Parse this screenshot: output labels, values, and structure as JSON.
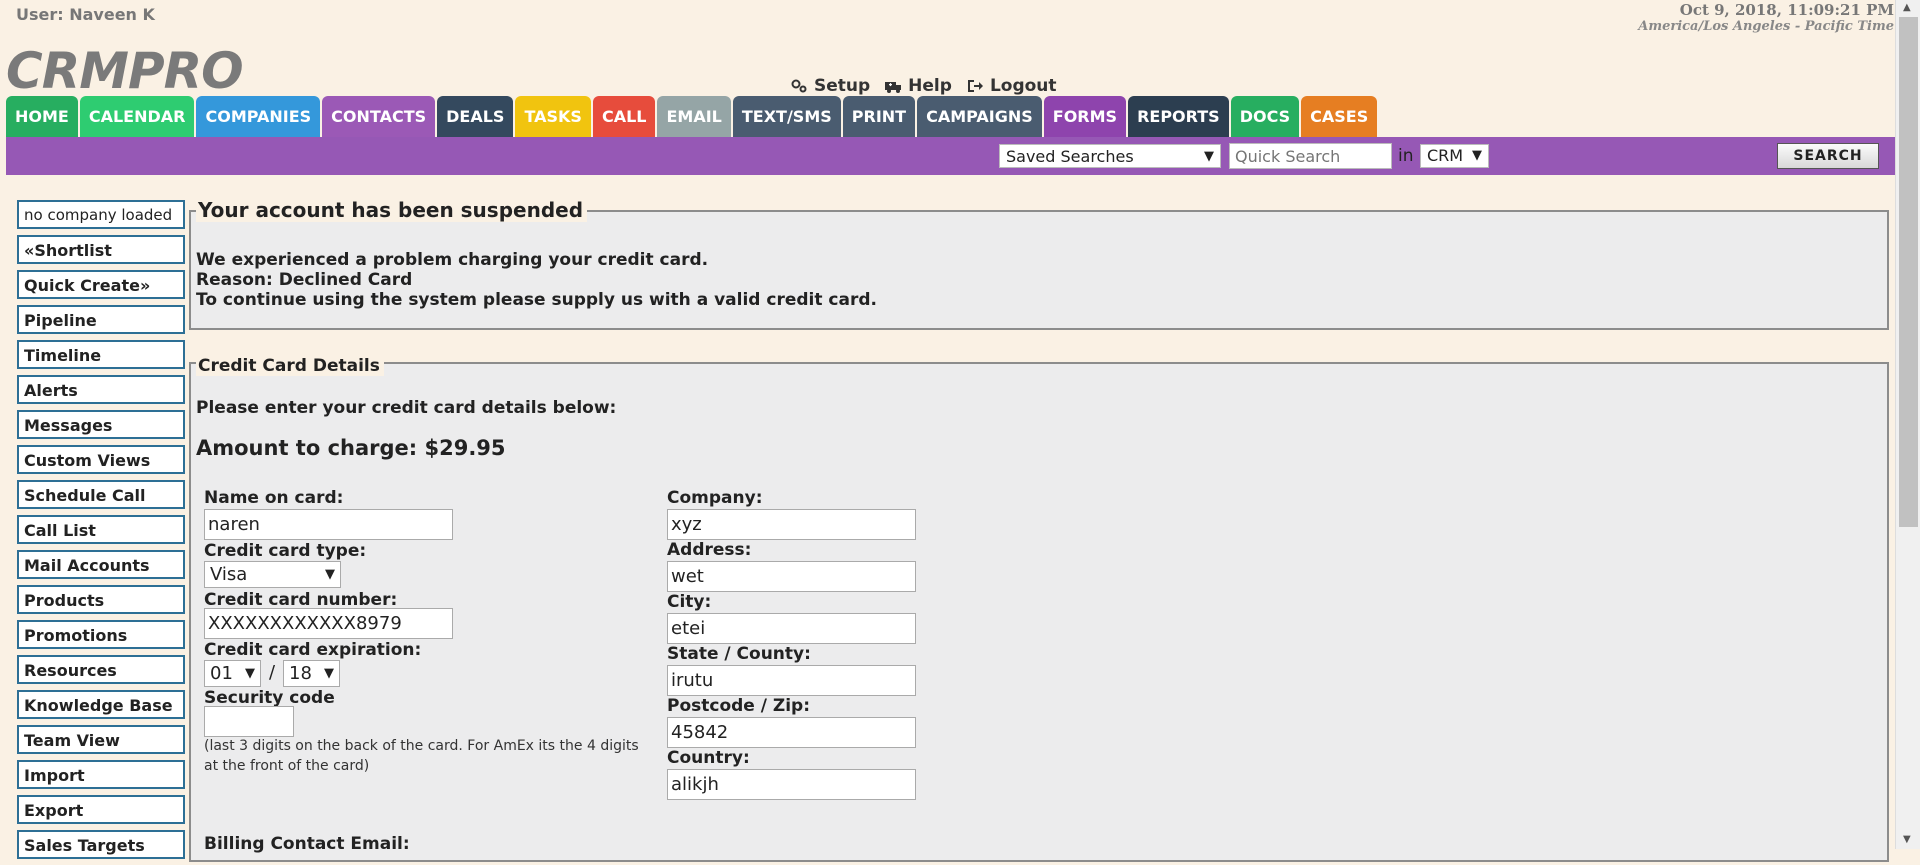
{
  "header": {
    "user": "User: Naveen K",
    "date": "Oct 9, 2018, 11:09:21 PM",
    "timezone": "America/Los Angeles - Pacific Time",
    "logo": "CRMPRO",
    "links": {
      "setup": "Setup",
      "help": "Help",
      "logout": "Logout"
    }
  },
  "nav": {
    "tabs": [
      {
        "label": "HOME",
        "color": "#27ae60"
      },
      {
        "label": "CALENDAR",
        "color": "#2ecc71"
      },
      {
        "label": "COMPANIES",
        "color": "#3498db"
      },
      {
        "label": "CONTACTS",
        "color": "#9b59b6"
      },
      {
        "label": "DEALS",
        "color": "#34495e"
      },
      {
        "label": "TASKS",
        "color": "#f1c40f"
      },
      {
        "label": "CALL",
        "color": "#e74c3c"
      },
      {
        "label": "EMAIL",
        "color": "#95a5a6"
      },
      {
        "label": "TEXT/SMS",
        "color": "#4a5c70"
      },
      {
        "label": "PRINT",
        "color": "#4a5c70"
      },
      {
        "label": "CAMPAIGNS",
        "color": "#4a5c70"
      },
      {
        "label": "FORMS",
        "color": "#8e44ad"
      },
      {
        "label": "REPORTS",
        "color": "#2c3e50"
      },
      {
        "label": "DOCS",
        "color": "#27ae60"
      },
      {
        "label": "CASES",
        "color": "#e67e22"
      }
    ]
  },
  "searchbar": {
    "saved_searches": "Saved Searches",
    "quick_search_placeholder": "Quick Search",
    "in_label": "in",
    "scope": "CRM",
    "search_button": "SEARCH"
  },
  "sidebar": {
    "company": "no company loaded",
    "items": [
      "«Shortlist",
      "Quick Create»",
      "Pipeline",
      "Timeline",
      "Alerts",
      "Messages",
      "Custom Views",
      "Schedule Call",
      "Call List",
      "Mail Accounts",
      "Products",
      "Promotions",
      "Resources",
      "Knowledge Base",
      "Team View",
      "Import",
      "Export",
      "Sales Targets"
    ]
  },
  "suspended": {
    "title": "Your account has been suspended",
    "line1": "We experienced a problem charging your credit card.",
    "line2": "Reason: Declined Card",
    "line3": "To continue using the system please supply us with a valid credit card."
  },
  "card": {
    "legend": "Credit Card Details",
    "intro": "Please enter your credit card details below:",
    "amount": "Amount to charge: $29.95",
    "name_label": "Name on card:",
    "name_value": "naren",
    "type_label": "Credit card type:",
    "type_value": "Visa",
    "number_label": "Credit card number:",
    "number_value": "XXXXXXXXXXXX8979",
    "expiry_label": "Credit card expiration:",
    "expiry_month": "01",
    "expiry_sep": "/",
    "expiry_year": "18",
    "security_label": "Security code",
    "security_hint": "(last 3 digits on the back of the card. For AmEx its the 4 digits at the front of the card)",
    "company_label": "Company:",
    "company_value": "xyz",
    "address_label": "Address:",
    "address_value": "wet",
    "city_label": "City:",
    "city_value": "etei",
    "state_label": "State / County:",
    "state_value": "irutu",
    "zip_label": "Postcode / Zip:",
    "zip_value": "45842",
    "country_label": "Country:",
    "country_value": "alikjh",
    "billing_label": "Billing Contact Email:"
  }
}
